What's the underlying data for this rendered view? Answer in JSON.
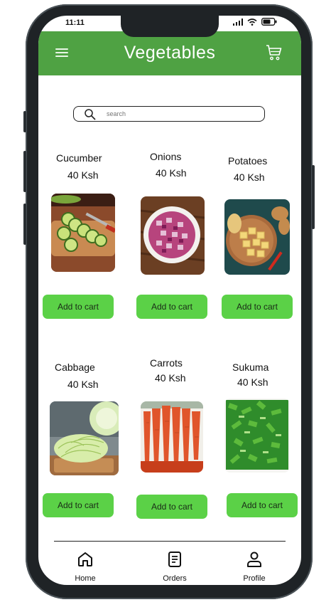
{
  "status": {
    "time": "11:11"
  },
  "header": {
    "title": "Vegetables"
  },
  "search": {
    "placeholder": "search"
  },
  "products": [
    {
      "name": "Cucumber",
      "price": "40 Ksh",
      "button": "Add to cart"
    },
    {
      "name": "Onions",
      "price": "40 Ksh",
      "button": "Add to cart"
    },
    {
      "name": "Potatoes",
      "price": "40 Ksh",
      "button": "Add to cart"
    },
    {
      "name": "Cabbage",
      "price": "40 Ksh",
      "button": "Add to cart"
    },
    {
      "name": "Carrots",
      "price": "40 Ksh",
      "button": "Add to cart"
    },
    {
      "name": "Sukuma",
      "price": "40 Ksh",
      "button": "Add to cart"
    }
  ],
  "nav": [
    {
      "label": "Home",
      "icon": "home-icon"
    },
    {
      "label": "Orders",
      "icon": "orders-icon"
    },
    {
      "label": "Profile",
      "icon": "profile-icon"
    }
  ],
  "colors": {
    "header": "#4fa243",
    "button": "#5bd147"
  }
}
